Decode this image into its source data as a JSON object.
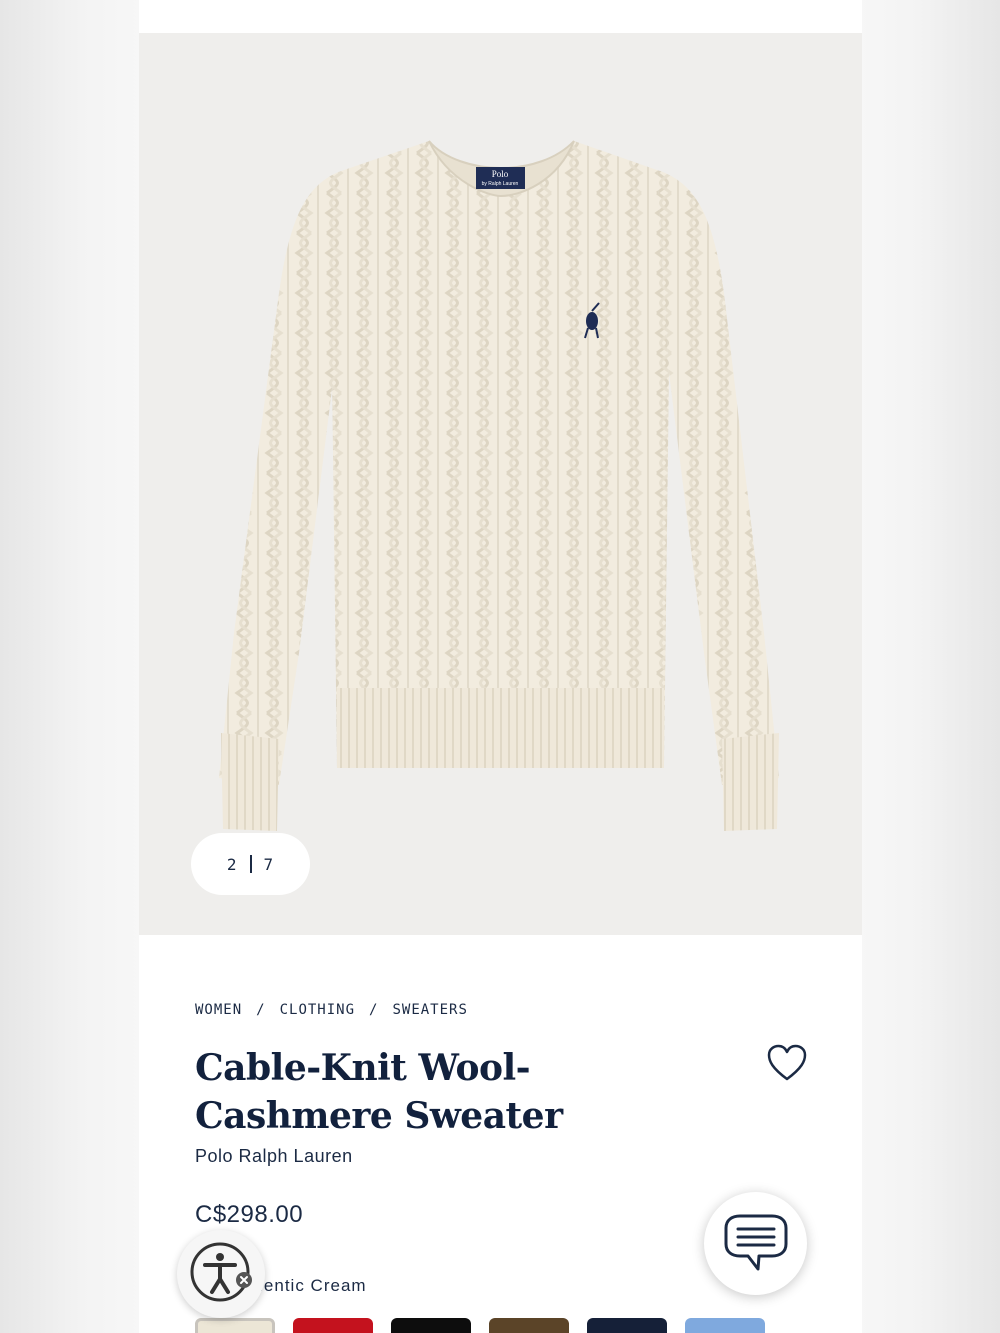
{
  "gallery": {
    "current": "2",
    "total": "7"
  },
  "breadcrumb": [
    "WOMEN",
    "CLOTHING",
    "SWEATERS"
  ],
  "product": {
    "title": "Cable-Knit Wool-Cashmere Sweater",
    "brand": "Polo Ralph Lauren",
    "price": "C$298.00",
    "color_label": "R:",
    "color_value": "Authentic Cream",
    "garment_label": "Polo",
    "garment_label_sub": "by Ralph Lauren"
  },
  "swatches": [
    {
      "name": "Authentic Cream",
      "color": "#ece6d6",
      "selected": true
    },
    {
      "name": "red",
      "color": "#c4121e"
    },
    {
      "name": "black",
      "color": "#0d0d0d"
    },
    {
      "name": "brown",
      "color": "#5b4428"
    },
    {
      "name": "navy",
      "color": "#152038"
    },
    {
      "name": "light blue",
      "color": "#7fa9de"
    }
  ],
  "colors": {
    "text": "#1b2a44",
    "hero_bg": "#efeeec",
    "sweater": "#f2ecdf"
  },
  "icons": {
    "wishlist": "heart-icon",
    "chat": "chat-bubble-icon",
    "accessibility": "accessibility-icon"
  }
}
